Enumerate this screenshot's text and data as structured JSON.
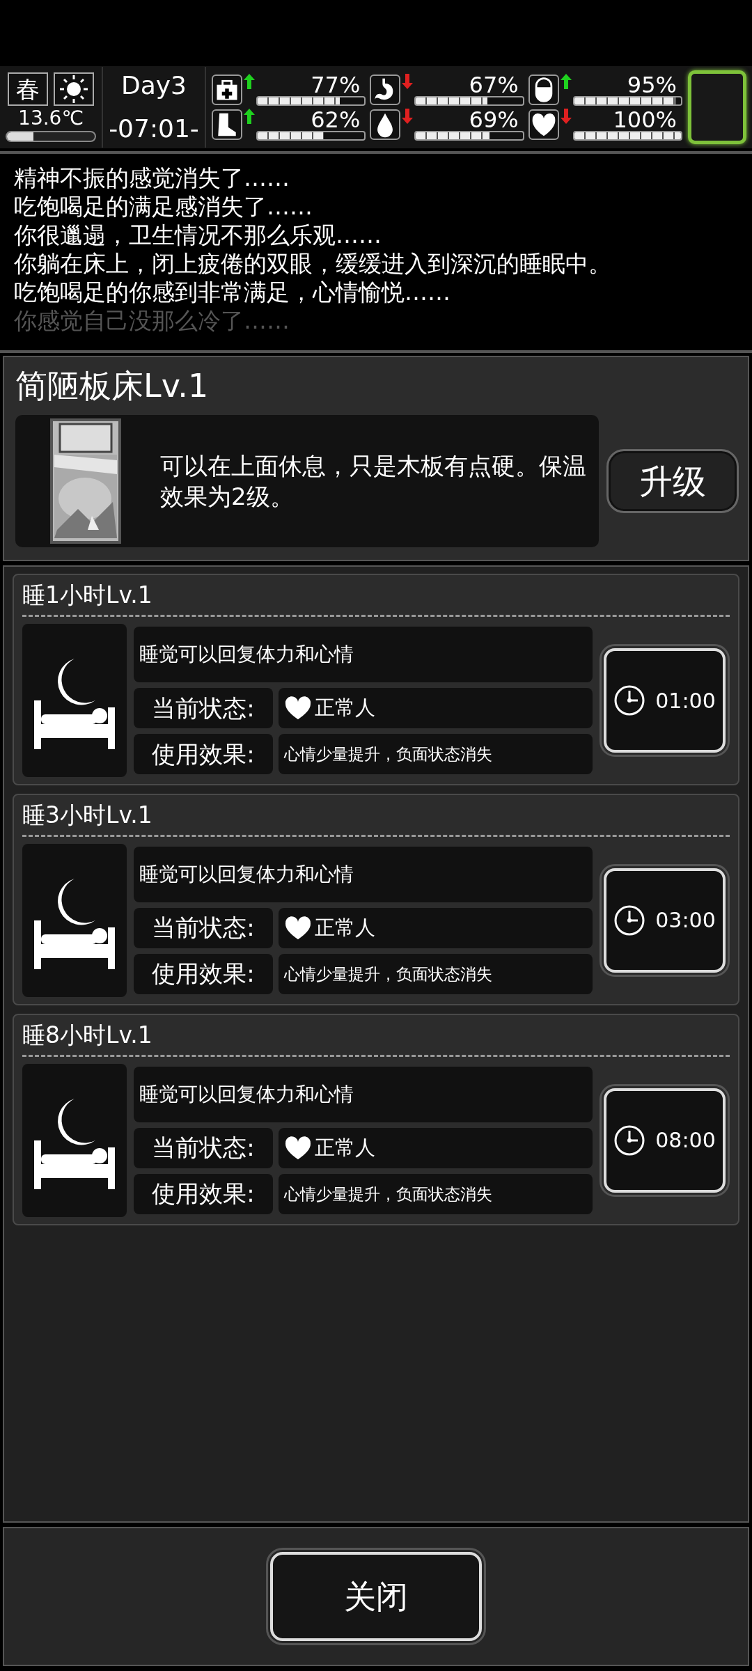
{
  "status_bar": {
    "season": "春",
    "temperature": "13.6℃",
    "thermometer": {
      "level": 0.3
    },
    "day": "Day3",
    "time": "-07:01-",
    "stats": [
      {
        "kind": "health",
        "rising": true,
        "value": "77%",
        "level": 0.77
      },
      {
        "kind": "stomach",
        "rising": false,
        "value": "67%",
        "level": 0.67
      },
      {
        "kind": "pill",
        "rising": true,
        "value": "95%",
        "level": 0.95
      },
      {
        "kind": "foot",
        "rising": true,
        "value": "62%",
        "level": 0.62
      },
      {
        "kind": "water",
        "rising": false,
        "value": "69%",
        "level": 0.69
      },
      {
        "kind": "heart",
        "rising": false,
        "value": "100%",
        "level": 1.0
      }
    ]
  },
  "log": [
    {
      "text": "精神不振的感觉消失了……",
      "faded": false
    },
    {
      "text": "吃饱喝足的满足感消失了……",
      "faded": false
    },
    {
      "text": "你很邋遢，卫生情况不那么乐观……",
      "faded": false
    },
    {
      "text": "你躺在床上，闭上疲倦的双眼，缓缓进入到深沉的睡眠中。",
      "faded": false
    },
    {
      "text": "吃饱喝足的你感到非常满足，心情愉悦……",
      "faded": false
    },
    {
      "text": "你感觉自己没那么冷了……",
      "faded": true
    }
  ],
  "bed": {
    "title": "简陋板床Lv.1",
    "description": "可以在上面休息，只是木板有点硬。保温效果为2级。",
    "upgrade_button": "升级"
  },
  "sleep_options": [
    {
      "title": "睡1小时Lv.1",
      "description": "睡觉可以回复体力和心情",
      "status_label": "当前状态:",
      "status": "正常人",
      "effect_label": "使用效果:",
      "effect": "心情少量提升，负面状态消失",
      "button": "01:00"
    },
    {
      "title": "睡3小时Lv.1",
      "description": "睡觉可以回复体力和心情",
      "status_label": "当前状态:",
      "status": "正常人",
      "effect_label": "使用效果:",
      "effect": "心情少量提升，负面状态消失",
      "button": "03:00"
    },
    {
      "title": "睡8小时Lv.1",
      "description": "睡觉可以回复体力和心情",
      "status_label": "当前状态:",
      "status": "正常人",
      "effect_label": "使用效果:",
      "effect": "心情少量提升，负面状态消失",
      "button": "08:00"
    }
  ],
  "close_button": "关闭"
}
